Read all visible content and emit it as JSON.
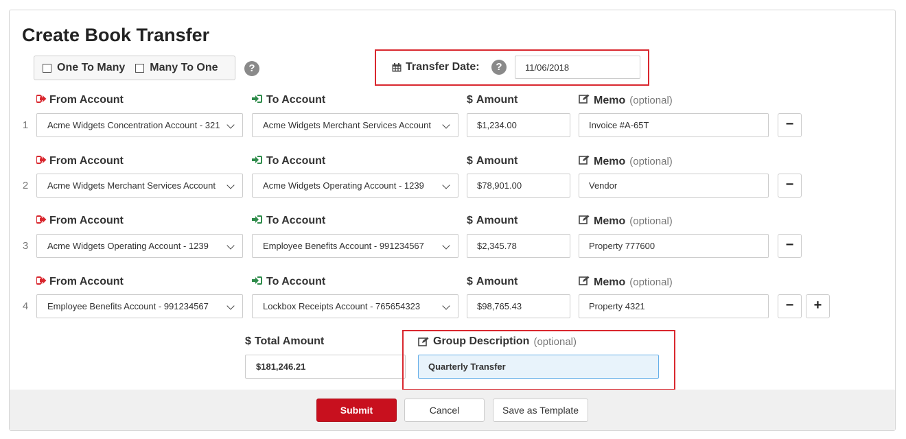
{
  "page": {
    "title": "Create Book Transfer"
  },
  "mode": {
    "one_to_many": "One To Many",
    "many_to_one": "Many To One",
    "help": "?"
  },
  "transfer_date": {
    "label": "Transfer Date:",
    "value": "11/06/2018",
    "help": "?"
  },
  "labels": {
    "from": "From Account",
    "to": "To Account",
    "amount": "Amount",
    "memo": "Memo",
    "optional": "(optional)",
    "currency": "$"
  },
  "rows": [
    {
      "num": "1",
      "from": "Acme Widgets Concentration Account - 321",
      "to": "Acme Widgets Merchant Services Account",
      "amount": "$1,234.00",
      "memo": "Invoice #A-65T"
    },
    {
      "num": "2",
      "from": "Acme Widgets Merchant Services Account",
      "to": "Acme Widgets Operating Account - 1239",
      "amount": "$78,901.00",
      "memo": "Vendor"
    },
    {
      "num": "3",
      "from": "Acme Widgets Operating Account - 1239",
      "to": "Employee Benefits Account - 991234567",
      "amount": "$2,345.78",
      "memo": "Property 777600"
    },
    {
      "num": "4",
      "from": "Employee Benefits Account - 991234567",
      "to": "Lockbox Receipts Account - 765654323",
      "amount": "$98,765.43",
      "memo": "Property 4321"
    }
  ],
  "row_buttons": {
    "remove": "−",
    "add": "+"
  },
  "total": {
    "label": "Total Amount",
    "value": "$181,246.21"
  },
  "group": {
    "label": "Group Description",
    "optional": "(optional)",
    "value": "Quarterly Transfer"
  },
  "actions": {
    "submit": "Submit",
    "cancel": "Cancel",
    "save_template": "Save as Template"
  },
  "colors": {
    "primary": "#c8101e",
    "from_icon": "#d9272e",
    "to_icon": "#2e8b4a",
    "highlight_border": "#d9272e",
    "focused_input_bg": "#e8f3fb",
    "focused_input_border": "#66afe9"
  }
}
